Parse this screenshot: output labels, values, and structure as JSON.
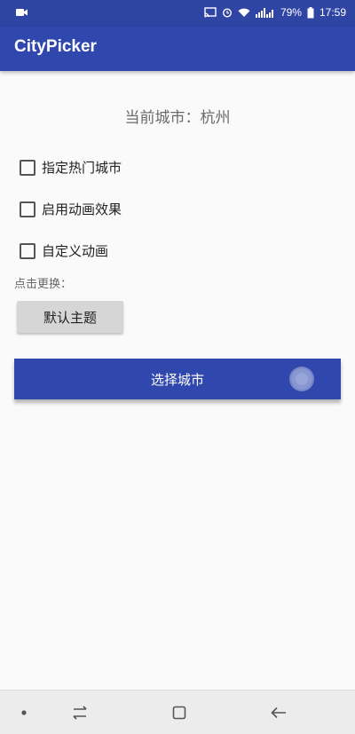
{
  "status_bar": {
    "battery_percent": "79%",
    "time": "17:59",
    "icons": [
      "video-icon",
      "cast-icon",
      "alarm-icon",
      "wifi-icon",
      "signal-icon",
      "battery-icon"
    ]
  },
  "app_bar": {
    "title": "CityPicker"
  },
  "main": {
    "current_city": "当前城市：杭州",
    "options": [
      {
        "label": "指定热门城市",
        "checked": false
      },
      {
        "label": "启用动画效果",
        "checked": false
      },
      {
        "label": "自定义动画",
        "checked": false
      }
    ],
    "change_label": "点击更换：",
    "theme_button_label": "默认主题",
    "pick_button_label": "选择城市"
  },
  "nav_bar": {
    "items": [
      "dot-icon",
      "recent-apps-icon",
      "home-icon",
      "back-icon"
    ]
  },
  "colors": {
    "primary": "#3047ad",
    "status_bar": "#2f45a4",
    "background": "#fafafa"
  }
}
